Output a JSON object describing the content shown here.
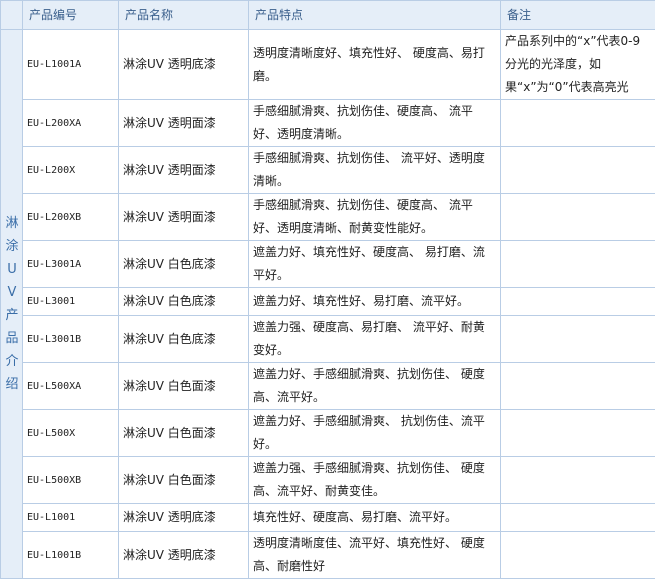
{
  "headers": {
    "code": "产品编号",
    "name": "产品名称",
    "features": "产品特点",
    "note": "备注"
  },
  "side_label": "淋涂UV产品介绍",
  "note_text": "产品系列中的“x”代表0-9分光的光泽度，如果“x”为“0”代表高亮光",
  "rows": [
    {
      "code": "EU-L1001A",
      "name": "淋涂UV 透明底漆",
      "features": "透明度清晰度好、填充性好、 硬度高、易打磨。"
    },
    {
      "code": "EU-L200XA",
      "name": "淋涂UV 透明面漆",
      "features": "手感细腻滑爽、抗划伤佳、硬度高、 流平好、透明度清晰。"
    },
    {
      "code": "EU-L200X",
      "name": "淋涂UV 透明面漆",
      "features": "手感细腻滑爽、抗划伤佳、 流平好、透明度清晰。"
    },
    {
      "code": "EU-L200XB",
      "name": "淋涂UV 透明面漆",
      "features": "手感细腻滑爽、抗划伤佳、硬度高、 流平好、透明度清晰、耐黄变性能好。"
    },
    {
      "code": "EU-L3001A",
      "name": "淋涂UV 白色底漆",
      "features": "遮盖力好、填充性好、硬度高、 易打磨、流平好。"
    },
    {
      "code": "EU-L3001",
      "name": "淋涂UV 白色底漆",
      "features": "遮盖力好、填充性好、易打磨、流平好。"
    },
    {
      "code": "EU-L3001B",
      "name": "淋涂UV 白色底漆",
      "features": "遮盖力强、硬度高、易打磨、 流平好、耐黄变好。"
    },
    {
      "code": "EU-L500XA",
      "name": "淋涂UV 白色面漆",
      "features": "遮盖力好、手感细腻滑爽、抗划伤佳、 硬度高、流平好。"
    },
    {
      "code": "EU-L500X",
      "name": "淋涂UV 白色面漆",
      "features": "遮盖力好、手感细腻滑爽、 抗划伤佳、流平好。"
    },
    {
      "code": "EU-L500XB",
      "name": "淋涂UV 白色面漆",
      "features": "遮盖力强、手感细腻滑爽、抗划伤佳、 硬度高、流平好、耐黄变佳。"
    },
    {
      "code": "EU-L1001",
      "name": "淋涂UV 透明底漆",
      "features": "填充性好、硬度高、易打磨、流平好。"
    },
    {
      "code": "EU-L1001B",
      "name": "淋涂UV 透明底漆",
      "features": "透明度清晰度佳、流平好、填充性好、 硬度高、耐磨性好"
    }
  ]
}
